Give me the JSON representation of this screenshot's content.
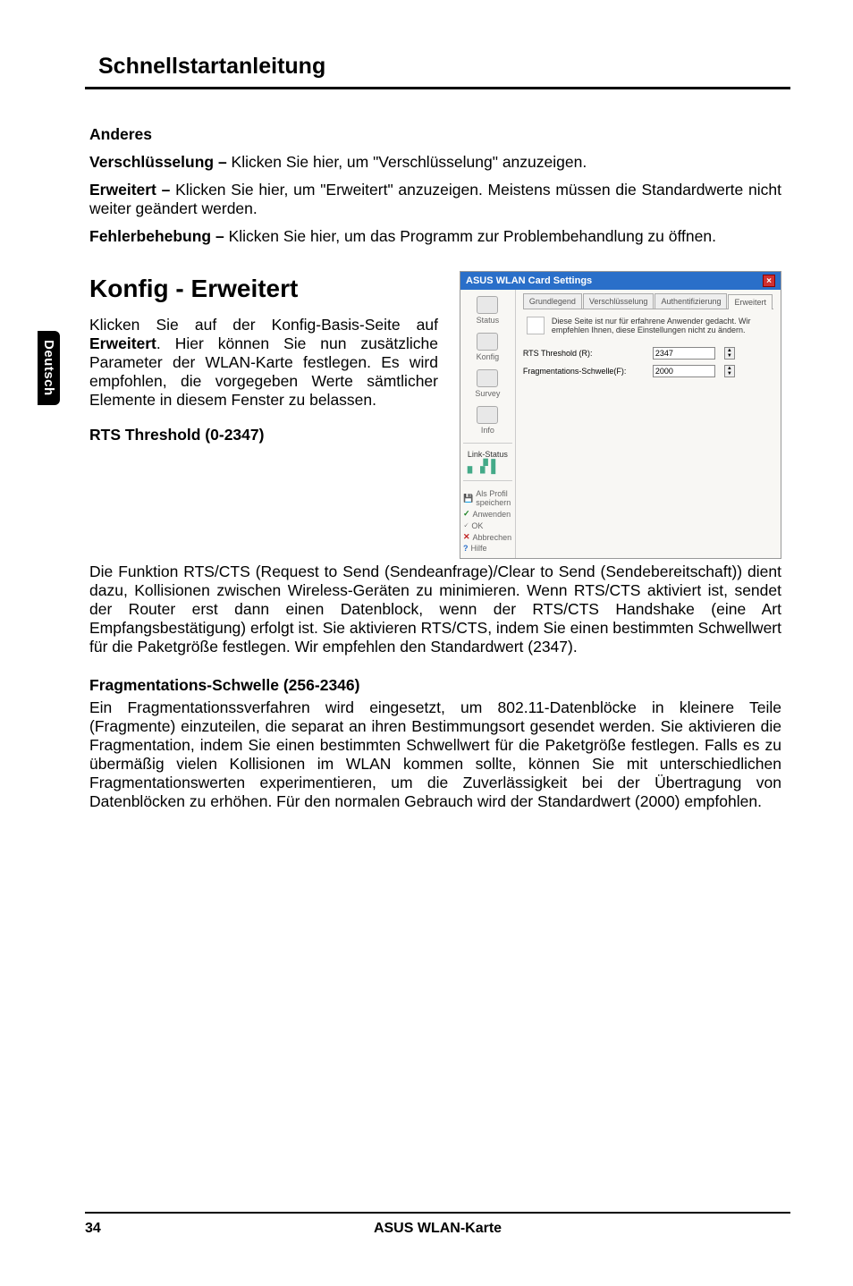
{
  "header": {
    "title": "Schnellstartanleitung"
  },
  "sideTab": "Deutsch",
  "sections": {
    "anderes": {
      "heading": "Anderes",
      "enc": {
        "label": "Verschlüsselung – ",
        "text": "Klicken Sie hier, um \"Verschlüsselung\" anzuzeigen."
      },
      "adv": {
        "label": "Erweitert – ",
        "text": "Klicken Sie hier, um \"Erweitert\" anzuzeigen. Meistens müssen die Standardwerte nicht weiter geändert werden."
      },
      "trouble": {
        "label": "Fehlerbehebung – ",
        "text": "Klicken Sie hier, um das Programm zur Problem­behandlung zu öffnen."
      }
    },
    "konfig": {
      "heading": "Konfig - Erweitert",
      "intro_prefix": "Klicken Sie auf der Konfig-Basis-Seite auf ",
      "intro_bold": "Erweitert",
      "intro_suffix": ". Hier können Sie nun zusätzliche Parameter der WLAN-Karte festlegen. Es wird empfohlen, die vorgegeben Werte sämtlicher Elemente in diesem Fenster zu belassen."
    },
    "rts": {
      "heading": "RTS Threshold (0-2347)",
      "text": "Die Funktion RTS/CTS (Request to Send (Sendeanfrage)/Clear to Send (Sendebereitschaft)) dient dazu, Kollisionen zwischen Wireless-Geräten zu minimieren. Wenn RTS/CTS aktiviert ist, sendet der Router erst dann einen Datenblock, wenn der RTS/CTS Handshake (eine Art Empfangsbestätigung) erfolgt ist. Sie aktivieren RTS/CTS, indem Sie einen bestimmten Schwellwert für die Paketgröße festlegen. Wir empfehlen den Standardwert (2347)."
    },
    "frag": {
      "heading": "Fragmentations-Schwelle (256-2346)",
      "text": "Ein Fragmentationssverfahren wird eingesetzt, um 802.11-Datenblöcke in kleinere Teile (Fragmente) einzuteilen, die separat an ihren Bestimmungsort gesendet werden. Sie aktivieren die Fragmentation, indem Sie einen bestimmten Schwellwert für die Paketgröße festlegen. Falls es zu übermäßig vielen Kollisionen im WLAN kommen sollte, können Sie mit unterschiedlichen Fragmentationswerten experimentieren, um die Zuverlässigkeit bei der Übertragung von Datenblöcken zu erhöhen. Für den normalen Gebrauch wird der Standardwert (2000) empfohlen."
    }
  },
  "screenshot": {
    "title": "ASUS WLAN Card Settings",
    "close": "×",
    "sidebar": {
      "status": "Status",
      "konfig": "Konfig",
      "survey": "Survey",
      "info": "Info",
      "linkStatus": "Link-Status",
      "saveProfile": "Als Profil speichern",
      "apply": "Anwenden",
      "ok": "OK",
      "cancel": "Abbrechen",
      "help": "Hilfe"
    },
    "tabs": {
      "basic": "Grundlegend",
      "encryption": "Verschlüsselung",
      "auth": "Authentifizierung",
      "advanced": "Erweitert"
    },
    "hint": "Diese Seite ist nur für erfahrene Anwender gedacht. Wir empfehlen Ihnen, diese Einstellungen nicht zu ändern.",
    "fields": {
      "rts": {
        "label": "RTS Threshold (R):",
        "value": "2347"
      },
      "frag": {
        "label": "Fragmentations-Schwelle(F):",
        "value": "2000"
      }
    }
  },
  "footer": {
    "page": "34",
    "product": "ASUS WLAN-Karte"
  }
}
